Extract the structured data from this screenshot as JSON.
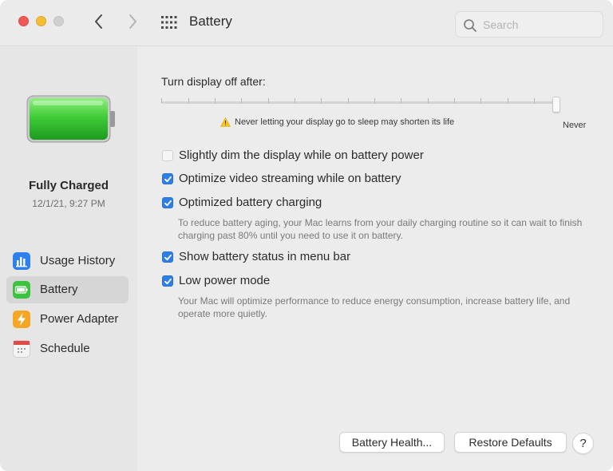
{
  "window": {
    "title": "Battery",
    "traffic_lights": [
      "close",
      "minimize",
      "zoom"
    ]
  },
  "toolbar": {
    "back_icon": "chevron-left-icon",
    "forward_icon": "chevron-right-icon",
    "grid_icon": "show-all-grid-icon",
    "search_placeholder": "Search"
  },
  "sidebar": {
    "battery_icon": "battery-full-icon",
    "status": "Fully Charged",
    "date": "12/1/21, 9:27 PM",
    "items": [
      {
        "label": "Usage History",
        "icon": "bar-chart-icon",
        "color": "#2e7ff0",
        "selected": false
      },
      {
        "label": "Battery",
        "icon": "battery-icon",
        "color": "#3cc23f",
        "selected": true
      },
      {
        "label": "Power Adapter",
        "icon": "lightning-bolt-icon",
        "color": "#f5a623",
        "selected": false
      },
      {
        "label": "Schedule",
        "icon": "calendar-icon",
        "color": "#e04b45",
        "selected": false
      }
    ]
  },
  "main": {
    "display_off_label": "Turn display off after:",
    "slider_value_label": "Never",
    "slider_level": 1.0,
    "warning_text": "Never letting your display go to sleep may shorten its life",
    "options": [
      {
        "label": "Slightly dim the display while on battery power",
        "checked": false
      },
      {
        "label": "Optimize video streaming while on battery",
        "checked": true
      },
      {
        "label": "Optimized battery charging",
        "checked": true
      },
      {
        "label": "Show battery status in menu bar",
        "checked": true
      },
      {
        "label": "Low power mode",
        "checked": true
      }
    ],
    "optimized_charging_desc": "To reduce battery aging, your Mac learns from your daily charging routine so it can wait to finish charging past 80% until you need to use it on battery.",
    "low_power_desc": "Your Mac will optimize performance to reduce energy consumption, increase battery life, and operate more quietly.",
    "battery_health_button": "Battery Health...",
    "restore_defaults_button": "Restore Defaults",
    "help_button": "?"
  },
  "colors": {
    "accent": "#2f7ee6",
    "battery_green": "#3cc23f",
    "warning_yellow": "#f5c518"
  }
}
